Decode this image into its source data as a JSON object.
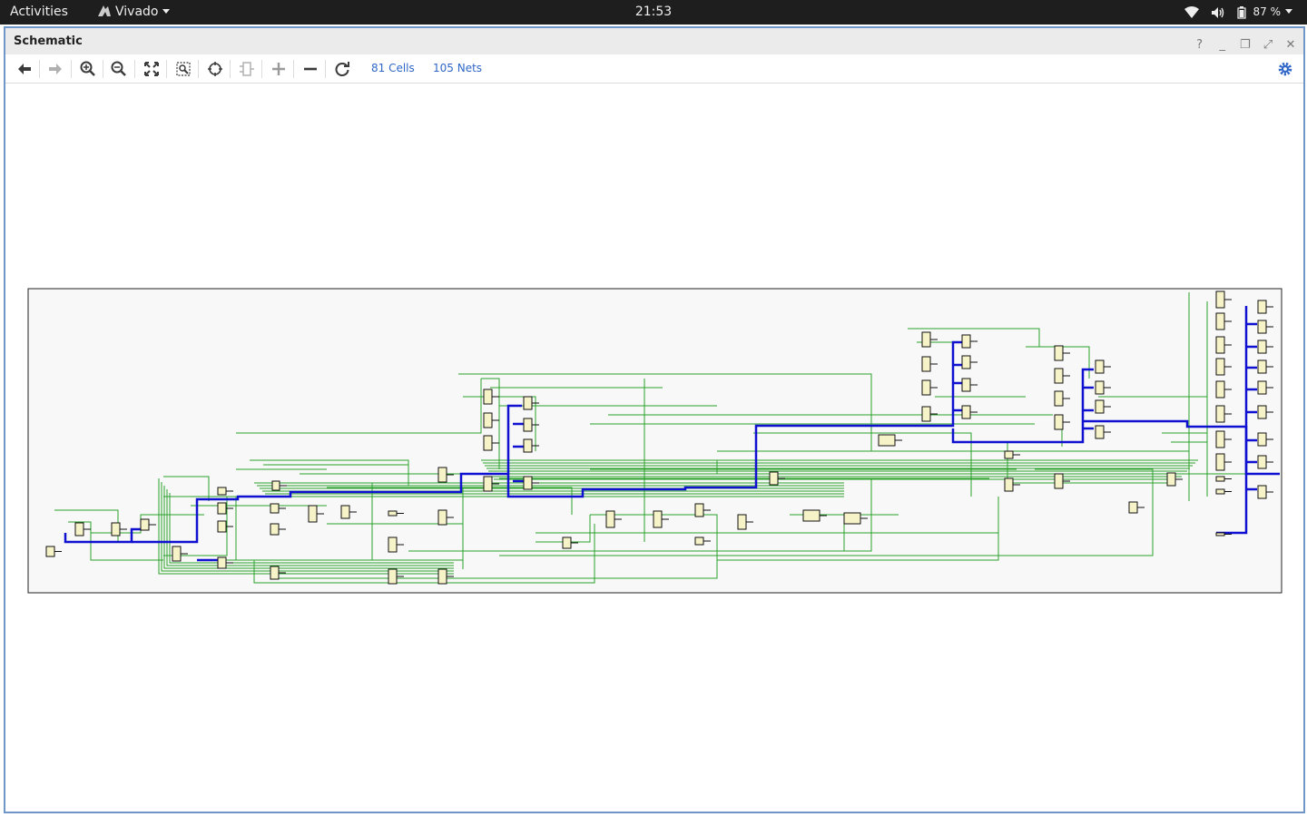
{
  "topbar": {
    "activities": "Activities",
    "app_name": "Vivado",
    "clock": "21:53",
    "battery": "87 %"
  },
  "window": {
    "title": "Schematic"
  },
  "toolbar": {
    "cells": "81 Cells",
    "nets": "105 Nets",
    "buttons": [
      "back-icon",
      "forward-icon",
      "zoom-in-icon",
      "zoom-out-icon",
      "fit-icon",
      "zoom-area-icon",
      "select-icon",
      "ports-icon",
      "expand-icon",
      "collapse-icon",
      "regenerate-icon"
    ]
  },
  "schematic": {
    "net_color": "#2aa02a",
    "highlight_net_color": "#1010d0",
    "cell_fill": "#f7f3c8",
    "frame_bg": "#f8f8f8",
    "accent": "#2f66c7"
  }
}
